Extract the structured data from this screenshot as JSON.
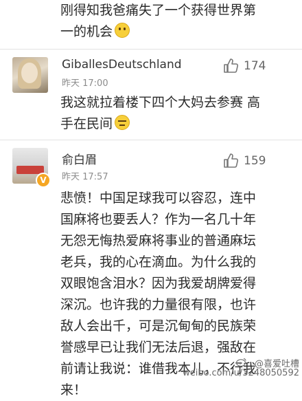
{
  "comments": [
    {
      "lines": [
        "刚得知我爸痛失了一个获得世界第",
        "一的机会"
      ],
      "emoji": "thinking-face"
    },
    {
      "author": "GiballesDeutschland",
      "time": "昨天 17:00",
      "likes": "174",
      "lines": [
        "我这就拉着楼下四个大妈去参赛 高",
        "手在民间"
      ],
      "emoji": "unamused-face"
    },
    {
      "author": "俞白眉",
      "time": "昨天 17:57",
      "likes": "159",
      "verified": true,
      "lines": [
        "悲愤！中国足球我可以容忍，连中",
        "国麻将也要丢人？作为一名几十年",
        "无怨无悔热爱麻将事业的普通麻坛",
        "老兵，我的心在滴血。为什么我的",
        "双眼饱含泪水？因为我爱胡牌爱得",
        "深沉。也许我的力量很有限，也许",
        "敌人会出千，可是沉甸甸的民族荣",
        "誉感早已让我们无法后退，强敌在",
        "前请让我说：谁借我本儿，不行我",
        "来！"
      ]
    }
  ],
  "watermark": {
    "handle": "@喜爱吐槽",
    "url": "weibo.com/u/3248050592"
  },
  "colors": {
    "text": "#2b2b2b",
    "meta": "#8c8c8c",
    "divider": "#e2e2e2",
    "verified_badge": "#f5a623"
  }
}
